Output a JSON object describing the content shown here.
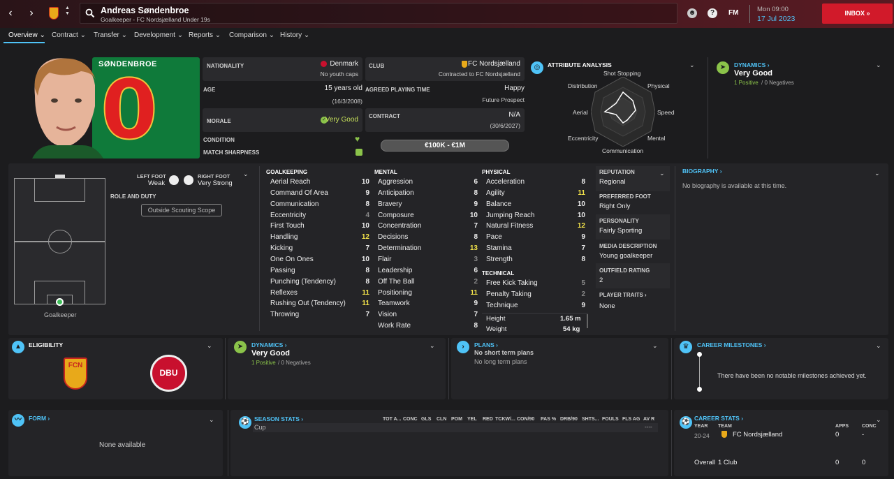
{
  "header": {
    "title": "Andreas Søndenbroe",
    "subtitle": "Goalkeeper - FC Nordsjælland Under 19s",
    "date_day": "Mon 09:00",
    "date_full": "17 Jul 2023",
    "inbox": "INBOX",
    "fm": "FM"
  },
  "tabs": [
    "Overview",
    "Contract",
    "Transfer",
    "Development",
    "Reports",
    "Comparison",
    "History"
  ],
  "profile": {
    "shirt_name": "SØNDENBROE",
    "shirt_number": "0",
    "nationality_label": "NATIONALITY",
    "nationality": "Denmark",
    "youth_caps": "No youth caps",
    "age_label": "AGE",
    "age": "15 years old",
    "dob": "(16/3/2008)",
    "morale_label": "MORALE",
    "morale": "Very Good",
    "condition_label": "CONDITION",
    "sharpness_label": "MATCH SHARPNESS",
    "club_label": "CLUB",
    "club": "FC Nordsjælland",
    "club_sub": "Contracted to FC Nordsjælland",
    "playing_time_label": "AGREED PLAYING TIME",
    "playing_time": "Happy",
    "playing_time_sub": "Future Prospect",
    "contract_label": "CONTRACT",
    "contract": "N/A",
    "contract_sub": "(30/6/2027)",
    "value": "€100K - €1M"
  },
  "attr_analysis": {
    "title": "ATTRIBUTE ANALYSIS",
    "labels": [
      "Shot Stopping",
      "Physical",
      "Speed",
      "Mental",
      "Communication",
      "Eccentricity",
      "Aerial",
      "Distribution"
    ]
  },
  "dynamics_top": {
    "title": "DYNAMICS",
    "value": "Very Good",
    "positive": "1 Positive",
    "negative": "0 Negatives"
  },
  "position": {
    "left_foot_label": "LEFT FOOT",
    "left_foot": "Weak",
    "right_foot_label": "RIGHT FOOT",
    "right_foot": "Very Strong",
    "role_label": "ROLE AND DUTY",
    "scope": "Outside Scouting Scope",
    "pos": "Goalkeeper"
  },
  "goalkeeping": {
    "title": "GOALKEEPING",
    "rows": [
      [
        "Aerial Reach",
        "10"
      ],
      [
        "Command Of Area",
        "9"
      ],
      [
        "Communication",
        "8"
      ],
      [
        "Eccentricity",
        "4"
      ],
      [
        "First Touch",
        "10"
      ],
      [
        "Handling",
        "12"
      ],
      [
        "Kicking",
        "7"
      ],
      [
        "One On Ones",
        "10"
      ],
      [
        "Passing",
        "8"
      ],
      [
        "Punching (Tendency)",
        "8"
      ],
      [
        "Reflexes",
        "11"
      ],
      [
        "Rushing Out (Tendency)",
        "11"
      ],
      [
        "Throwing",
        "7"
      ]
    ]
  },
  "mental": {
    "title": "MENTAL",
    "rows": [
      [
        "Aggression",
        "6"
      ],
      [
        "Anticipation",
        "8"
      ],
      [
        "Bravery",
        "9"
      ],
      [
        "Composure",
        "10"
      ],
      [
        "Concentration",
        "7"
      ],
      [
        "Decisions",
        "8"
      ],
      [
        "Determination",
        "13"
      ],
      [
        "Flair",
        "3"
      ],
      [
        "Leadership",
        "6"
      ],
      [
        "Off The Ball",
        "2"
      ],
      [
        "Positioning",
        "11"
      ],
      [
        "Teamwork",
        "9"
      ],
      [
        "Vision",
        "7"
      ],
      [
        "Work Rate",
        "8"
      ]
    ]
  },
  "physical": {
    "title": "PHYSICAL",
    "rows": [
      [
        "Acceleration",
        "8"
      ],
      [
        "Agility",
        "11"
      ],
      [
        "Balance",
        "10"
      ],
      [
        "Jumping Reach",
        "10"
      ],
      [
        "Natural Fitness",
        "12"
      ],
      [
        "Pace",
        "9"
      ],
      [
        "Stamina",
        "7"
      ],
      [
        "Strength",
        "8"
      ]
    ]
  },
  "technical": {
    "title": "TECHNICAL",
    "rows": [
      [
        "Free Kick Taking",
        "5"
      ],
      [
        "Penalty Taking",
        "2"
      ],
      [
        "Technique",
        "9"
      ]
    ]
  },
  "body": {
    "height_label": "Height",
    "height": "1.65 m",
    "weight_label": "Weight",
    "weight": "54 kg"
  },
  "info": {
    "reputation_label": "REPUTATION",
    "reputation": "Regional",
    "foot_label": "PREFERRED FOOT",
    "foot": "Right Only",
    "personality_label": "PERSONALITY",
    "personality": "Fairly Sporting",
    "media_label": "MEDIA DESCRIPTION",
    "media": "Young goalkeeper",
    "outfield_label": "OUTFIELD RATING",
    "outfield": "2",
    "traits_label": "PLAYER TRAITS",
    "traits": "None"
  },
  "biography": {
    "title": "BIOGRAPHY",
    "text": "No biography is available at this time."
  },
  "eligibility": {
    "title": "ELIGIBILITY",
    "fcn": "FCN",
    "dbu": "DBU"
  },
  "dynamics_mid": {
    "title": "DYNAMICS",
    "value": "Very Good",
    "positive": "1 Positive",
    "negative": "0 Negatives"
  },
  "plans": {
    "title": "PLANS",
    "short": "No short term plans",
    "long": "No long term plans"
  },
  "milestones": {
    "title": "CAREER MILESTONES",
    "text": "There have been no notable milestones achieved yet."
  },
  "form": {
    "title": "FORM",
    "text": "None available"
  },
  "season_stats": {
    "title": "SEASON STATS",
    "headers": [
      "TOT A...",
      "CONC",
      "GLS",
      "CLN",
      "POM",
      "YEL",
      "RED",
      "TCKW/...",
      "CON/90",
      "PAS %",
      "DRB/90",
      "SHTS...",
      "FOULS",
      "FLS AG",
      "AV R"
    ],
    "row_label": "Cup",
    "row_last": "----"
  },
  "career_stats": {
    "title": "CAREER STATS",
    "col_year": "YEAR",
    "col_team": "TEAM",
    "col_apps": "APPS",
    "col_conc": "CONC",
    "year": "20-24",
    "team": "FC Nordsjælland",
    "apps": "0",
    "conc": "-",
    "overall_label": "Overall",
    "overall_team": "1 Club",
    "overall_apps": "0",
    "overall_conc": "0"
  }
}
